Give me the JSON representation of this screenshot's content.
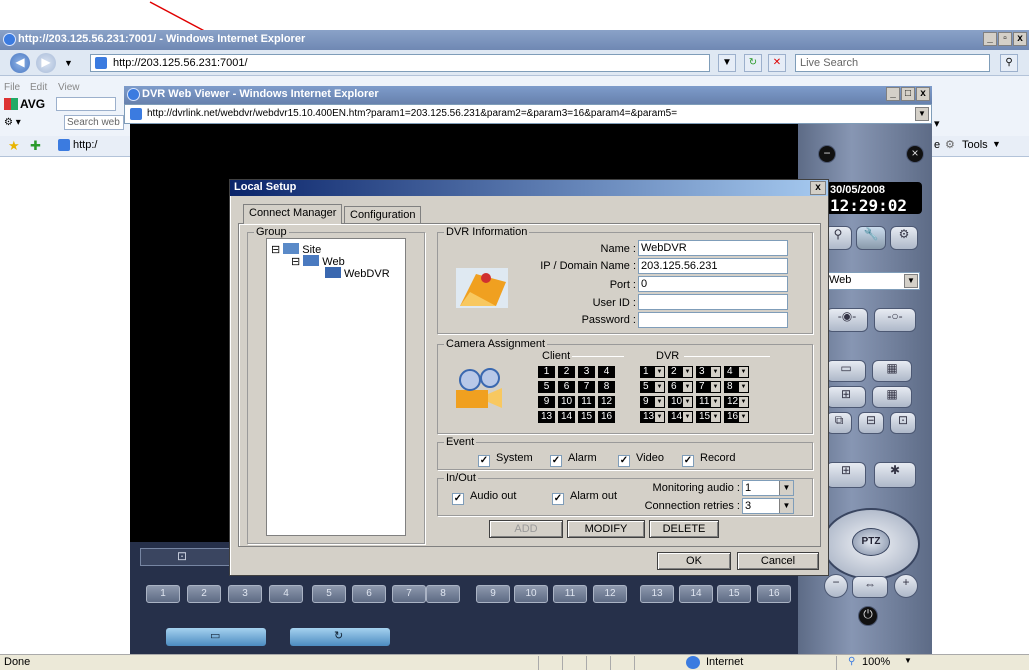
{
  "colors": {
    "ie_titlebar": "#6f88b3",
    "dialog_titlebar": "#0a246a",
    "dvr_bg": "#000000",
    "dvr_panel": "#5d6b86",
    "annotation_arrow": "#e00000"
  },
  "ie": {
    "title": "http://203.125.56.231:7001/ - Windows Internet Explorer",
    "address": "http://203.125.56.231:7001/",
    "search_placeholder": "Live Search",
    "menu_partial": [
      "File",
      "Edit",
      "View"
    ],
    "avg_label": "AVG",
    "search_web_placeholder": "Search web",
    "fav_link": "http:/",
    "tools_label": "Tools",
    "page_menu_partial": "e",
    "status_text": "Done",
    "zone_text": "Internet",
    "zoom_text": "100%"
  },
  "popup": {
    "title": "DVR Web Viewer - Windows Internet Explorer",
    "address": "http://dvrlink.net/webdvr/webdvr15.10.400EN.htm?param1=203.125.56.231&param2=&param3=16&param4=&param5="
  },
  "dvr_panel": {
    "date": "30/05/2008",
    "time": "12:29:02",
    "site_select": "Web",
    "ptz_label": "PTZ",
    "channels": [
      "1",
      "2",
      "3",
      "4",
      "5",
      "6",
      "7",
      "8",
      "9",
      "10",
      "11",
      "12",
      "13",
      "14",
      "15",
      "16"
    ]
  },
  "dialog": {
    "title": "Local Setup",
    "tabs": [
      "Connect Manager",
      "Configuration"
    ],
    "group_legend": "Group",
    "tree": {
      "root": "Site",
      "child": "Web",
      "leaf": "WebDVR"
    },
    "dvr_info": {
      "legend": "DVR Information",
      "name_label": "Name :",
      "name_value": "WebDVR",
      "ip_label": "IP / Domain Name :",
      "ip_value": "203.125.56.231",
      "port_label": "Port :",
      "port_value": "0",
      "user_label": "User ID :",
      "user_value": "",
      "password_label": "Password :",
      "password_value": ""
    },
    "camera": {
      "legend": "Camera Assignment",
      "client_label": "Client",
      "dvr_label": "DVR",
      "client_cells": [
        "1",
        "2",
        "3",
        "4",
        "5",
        "6",
        "7",
        "8",
        "9",
        "10",
        "11",
        "12",
        "13",
        "14",
        "15",
        "16"
      ],
      "dvr_cells": [
        "1",
        "2",
        "3",
        "4",
        "5",
        "6",
        "7",
        "8",
        "9",
        "10",
        "11",
        "12",
        "13",
        "14",
        "15",
        "16"
      ]
    },
    "event": {
      "legend": "Event",
      "items": [
        {
          "label": "System",
          "checked": true
        },
        {
          "label": "Alarm",
          "checked": true
        },
        {
          "label": "Video",
          "checked": true
        },
        {
          "label": "Record",
          "checked": true
        }
      ]
    },
    "inout": {
      "legend": "In/Out",
      "audio_out": "Audio out",
      "alarm_out": "Alarm out",
      "monitoring_label": "Monitoring audio :",
      "monitoring_value": "1",
      "retries_label": "Connection retries :",
      "retries_value": "3"
    },
    "buttons": {
      "add": "ADD",
      "modify": "MODIFY",
      "delete": "DELETE",
      "ok": "OK",
      "cancel": "Cancel"
    }
  }
}
